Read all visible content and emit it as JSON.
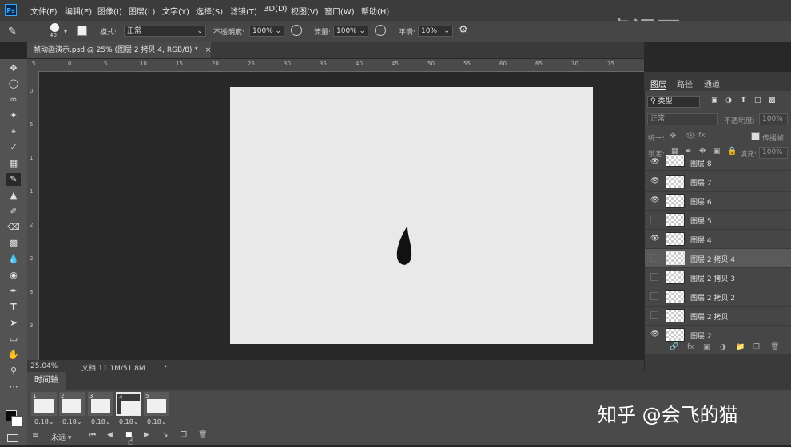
{
  "app": {
    "logo": "Ps"
  },
  "menu": [
    "文件(F)",
    "编辑(E)",
    "图像(I)",
    "图层(L)",
    "文字(Y)",
    "选择(S)",
    "滤镜(T)",
    "3D(D)",
    "视图(V)",
    "窗口(W)",
    "帮助(H)"
  ],
  "options": {
    "brush_size": "40",
    "mode_label": "模式:",
    "mode_value": "正常",
    "opacity_label": "不透明度:",
    "opacity_value": "100%",
    "flow_label": "流量:",
    "flow_value": "100%",
    "smooth_label": "平滑:",
    "smooth_value": "10%"
  },
  "document": {
    "tab_title": "帧动画演示.psd @ 25% (图层 2 拷贝 4, RGB/8) *",
    "close": "×"
  },
  "ruler": {
    "h_ticks": [
      "5",
      "0",
      "5",
      "10",
      "15",
      "20",
      "25",
      "30",
      "35",
      "40",
      "45",
      "50",
      "55",
      "60",
      "65",
      "70",
      "75"
    ],
    "v_ticks": [
      "0",
      "5",
      "1",
      "1",
      "2",
      "2",
      "3",
      "3"
    ]
  },
  "status": {
    "zoom": "25.04%",
    "doc_info": "文档:11.1M/51.8M",
    "arrow": "›"
  },
  "timeline": {
    "tab_label": "时间轴",
    "frames": [
      {
        "num": "1",
        "duration": "0.18"
      },
      {
        "num": "2",
        "duration": "0.18"
      },
      {
        "num": "3",
        "duration": "0.18"
      },
      {
        "num": "4",
        "duration": "0.18"
      },
      {
        "num": "5",
        "duration": "0.18"
      }
    ],
    "loop_value": "永远"
  },
  "panel": {
    "tabs": [
      "图层",
      "路径",
      "通道"
    ],
    "filter_kind": "类型",
    "blend_mode": "正常",
    "opacity_label": "不透明度:",
    "opacity_value": "100%",
    "unify_label": "统一:",
    "propagate_label": "传播帧",
    "lock_label": "锁定:",
    "fill_label": "填充:",
    "fill_value": "100%",
    "layers": [
      {
        "name": "图层 8",
        "visible": true
      },
      {
        "name": "图层 7",
        "visible": true
      },
      {
        "name": "图层 6",
        "visible": true
      },
      {
        "name": "图层 5",
        "visible": false
      },
      {
        "name": "图层 4",
        "visible": true
      },
      {
        "name": "图层 2 拷贝 4",
        "visible": false
      },
      {
        "name": "图层 2 拷贝 3",
        "visible": false
      },
      {
        "name": "图层 2 拷贝 2",
        "visible": false
      },
      {
        "name": "图层 2 拷贝",
        "visible": false
      },
      {
        "name": "图层 2",
        "visible": true
      }
    ]
  },
  "watermark": {
    "top": "虎课网",
    "bottom": "知乎 @会飞的猫"
  }
}
